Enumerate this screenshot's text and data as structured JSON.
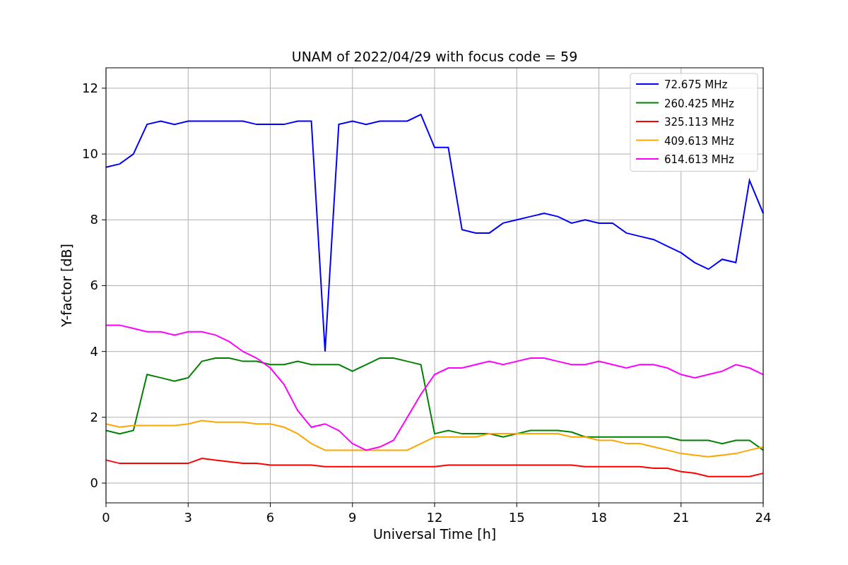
{
  "chart_data": {
    "type": "line",
    "title": "UNAM of 2022/04/29 with focus code = 59",
    "xlabel": "Universal Time [h]",
    "ylabel": "Y-factor [dB]",
    "x": [
      0,
      0.5,
      1,
      1.5,
      2,
      2.5,
      3,
      3.5,
      4,
      4.5,
      5,
      5.5,
      6,
      6.5,
      7,
      7.5,
      8,
      8.5,
      9,
      9.5,
      10,
      10.5,
      11,
      11.5,
      12,
      12.5,
      13,
      13.5,
      14,
      14.5,
      15,
      15.5,
      16,
      16.5,
      17,
      17.5,
      18,
      18.5,
      19,
      19.5,
      20,
      20.5,
      21,
      21.5,
      22,
      22.5,
      23,
      23.5,
      24
    ],
    "series": [
      {
        "name": "72.675 MHz",
        "color": "#0000ff",
        "values": [
          9.6,
          9.7,
          10.0,
          10.9,
          11.0,
          10.9,
          11.0,
          11.0,
          11.0,
          11.0,
          11.0,
          10.9,
          10.9,
          10.9,
          11.0,
          11.0,
          4.0,
          10.9,
          11.0,
          10.9,
          11.0,
          11.0,
          11.0,
          11.2,
          10.2,
          10.2,
          7.7,
          7.6,
          7.6,
          7.9,
          8.0,
          8.1,
          8.2,
          8.1,
          7.9,
          8.0,
          7.9,
          7.9,
          7.6,
          7.5,
          7.4,
          7.2,
          7.0,
          6.7,
          6.5,
          6.8,
          6.7,
          9.2,
          8.2
        ]
      },
      {
        "name": "260.425 MHz",
        "color": "#008000",
        "values": [
          1.6,
          1.5,
          1.6,
          3.3,
          3.2,
          3.1,
          3.2,
          3.7,
          3.8,
          3.8,
          3.7,
          3.7,
          3.6,
          3.6,
          3.7,
          3.6,
          3.6,
          3.6,
          3.4,
          3.6,
          3.8,
          3.8,
          3.7,
          3.6,
          1.5,
          1.6,
          1.5,
          1.5,
          1.5,
          1.4,
          1.5,
          1.6,
          1.6,
          1.6,
          1.55,
          1.4,
          1.4,
          1.4,
          1.4,
          1.4,
          1.4,
          1.4,
          1.3,
          1.3,
          1.3,
          1.2,
          1.3,
          1.3,
          1.0
        ]
      },
      {
        "name": "325.113 MHz",
        "color": "#ff0000",
        "values": [
          0.7,
          0.6,
          0.6,
          0.6,
          0.6,
          0.6,
          0.6,
          0.75,
          0.7,
          0.65,
          0.6,
          0.6,
          0.55,
          0.55,
          0.55,
          0.55,
          0.5,
          0.5,
          0.5,
          0.5,
          0.5,
          0.5,
          0.5,
          0.5,
          0.5,
          0.55,
          0.55,
          0.55,
          0.55,
          0.55,
          0.55,
          0.55,
          0.55,
          0.55,
          0.55,
          0.5,
          0.5,
          0.5,
          0.5,
          0.5,
          0.45,
          0.45,
          0.35,
          0.3,
          0.2,
          0.2,
          0.2,
          0.2,
          0.3
        ]
      },
      {
        "name": "409.613 MHz",
        "color": "#ffa500",
        "values": [
          1.8,
          1.7,
          1.75,
          1.75,
          1.75,
          1.75,
          1.8,
          1.9,
          1.85,
          1.85,
          1.85,
          1.8,
          1.8,
          1.7,
          1.5,
          1.2,
          1.0,
          1.0,
          1.0,
          1.0,
          1.0,
          1.0,
          1.0,
          1.2,
          1.4,
          1.4,
          1.4,
          1.4,
          1.5,
          1.5,
          1.5,
          1.5,
          1.5,
          1.5,
          1.4,
          1.4,
          1.3,
          1.3,
          1.2,
          1.2,
          1.1,
          1.0,
          0.9,
          0.85,
          0.8,
          0.85,
          0.9,
          1.0,
          1.1
        ]
      },
      {
        "name": "614.613 MHz",
        "color": "#ff00ff",
        "values": [
          4.8,
          4.8,
          4.7,
          4.6,
          4.6,
          4.5,
          4.6,
          4.6,
          4.5,
          4.3,
          4.0,
          3.8,
          3.5,
          3.0,
          2.2,
          1.7,
          1.8,
          1.6,
          1.2,
          1.0,
          1.1,
          1.3,
          2.0,
          2.7,
          3.3,
          3.5,
          3.5,
          3.6,
          3.7,
          3.6,
          3.7,
          3.8,
          3.8,
          3.7,
          3.6,
          3.6,
          3.7,
          3.6,
          3.5,
          3.6,
          3.6,
          3.5,
          3.3,
          3.2,
          3.3,
          3.4,
          3.6,
          3.5,
          3.3
        ]
      }
    ],
    "grid": true,
    "legend": true,
    "xlim": [
      0,
      24
    ],
    "ylim": [
      -0.6,
      12.62
    ],
    "xticks": [
      0,
      3,
      6,
      9,
      12,
      15,
      18,
      21,
      24
    ],
    "yticks": [
      0,
      2,
      4,
      6,
      8,
      10,
      12
    ]
  }
}
